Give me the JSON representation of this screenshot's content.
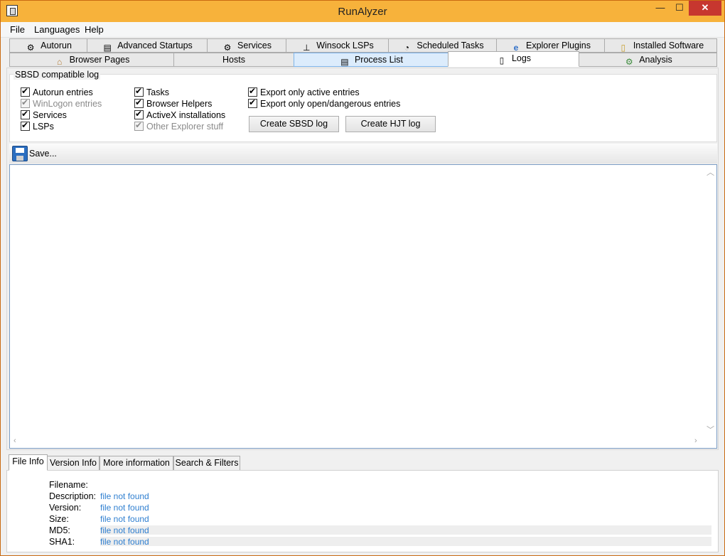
{
  "window": {
    "title": "RunAlyzer",
    "controls": {
      "minimize": "—",
      "maximize": "☐",
      "close": "✕"
    }
  },
  "menu": [
    "File",
    "Languages",
    "Help"
  ],
  "tabs_row1": [
    {
      "label": "Autorun",
      "icon": "autorun-icon",
      "glyph": "⚙"
    },
    {
      "label": "Advanced Startups",
      "icon": "advanced-startups-icon",
      "glyph": "▤"
    },
    {
      "label": "Services",
      "icon": "services-icon",
      "glyph": "⚙"
    },
    {
      "label": "Winsock LSPs",
      "icon": "winsock-icon",
      "glyph": "⊥"
    },
    {
      "label": "Scheduled Tasks",
      "icon": "scheduled-tasks-icon",
      "glyph": "◔"
    },
    {
      "label": "Explorer Plugins",
      "icon": "explorer-plugins-icon",
      "glyph": "e"
    },
    {
      "label": "Installed Software",
      "icon": "installed-software-icon",
      "glyph": "▯"
    }
  ],
  "tabs_row2": [
    {
      "label": "Browser Pages",
      "icon": "browser-pages-icon",
      "glyph": "⌂"
    },
    {
      "label": "Hosts",
      "icon": "",
      "glyph": ""
    },
    {
      "label": "Process List",
      "icon": "process-list-icon",
      "glyph": "▤"
    },
    {
      "label": "Logs",
      "icon": "logs-icon",
      "glyph": "▯"
    },
    {
      "label": "Analysis",
      "icon": "analysis-icon",
      "glyph": "⚙"
    }
  ],
  "logs": {
    "group_title": "SBSD compatible log",
    "checkboxes": [
      {
        "label": "Autorun entries",
        "checked": true,
        "enabled": true
      },
      {
        "label": "WinLogon entries",
        "checked": true,
        "enabled": false
      },
      {
        "label": "Services",
        "checked": true,
        "enabled": true
      },
      {
        "label": "LSPs",
        "checked": true,
        "enabled": true
      },
      {
        "label": "Tasks",
        "checked": true,
        "enabled": true
      },
      {
        "label": "Browser Helpers",
        "checked": true,
        "enabled": true
      },
      {
        "label": "ActiveX installations",
        "checked": true,
        "enabled": true
      },
      {
        "label": "Other Explorer stuff",
        "checked": true,
        "enabled": false
      },
      {
        "label": "Export only active entries",
        "checked": true,
        "enabled": true
      },
      {
        "label": "Export only open/dangerous entries",
        "checked": true,
        "enabled": true
      }
    ],
    "create_sbsd_button": "Create SBSD log",
    "create_hjt_button": "Create HJT log",
    "save_label": "Save...",
    "log_text": ""
  },
  "bottom_tabs": [
    "File Info",
    "Version Info",
    "More information",
    "Search & Filters"
  ],
  "file_info": {
    "labels": [
      "Filename:",
      "Description:",
      "Version:",
      "Size:",
      "MD5:",
      "SHA1:"
    ],
    "values": [
      "",
      "file not found",
      "file not found",
      "file not found",
      "file not found",
      "file not found"
    ]
  },
  "colors": {
    "titlebar": "#f7b23b",
    "close": "#c7372f",
    "link_value": "#2f7fd0"
  }
}
